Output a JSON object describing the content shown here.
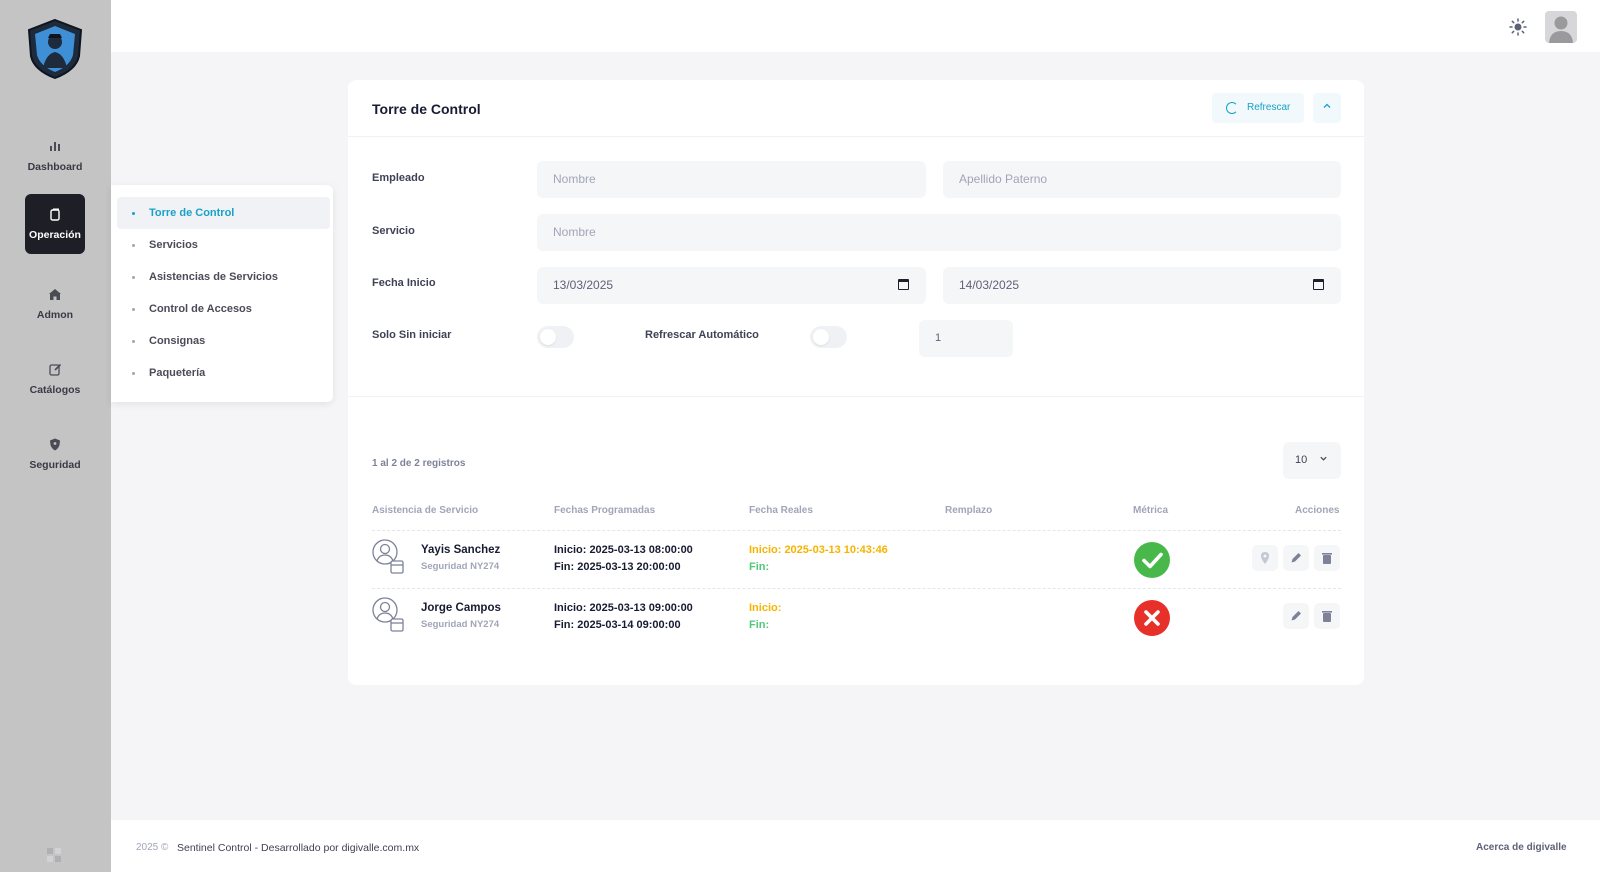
{
  "sidebar": {
    "items": [
      {
        "label": "Dashboard",
        "icon": "bar-chart-icon"
      },
      {
        "label": "Operación",
        "icon": "copy-icon"
      },
      {
        "label": "Admon",
        "icon": "home-icon"
      },
      {
        "label": "Catálogos",
        "icon": "edit-icon"
      },
      {
        "label": "Seguridad",
        "icon": "shield-icon"
      }
    ]
  },
  "submenu": {
    "items": [
      "Torre de Control",
      "Servicios",
      "Asistencias de Servicios",
      "Control de Accesos",
      "Consignas",
      "Paquetería"
    ]
  },
  "card": {
    "title": "Torre de Control",
    "refresh_label": "Refrescar"
  },
  "filters": {
    "empleado_label": "Empleado",
    "nombre_placeholder": "Nombre",
    "apellido_placeholder": "Apellido Paterno",
    "servicio_label": "Servicio",
    "servicio_placeholder": "Nombre",
    "fecha_label": "Fecha Inicio",
    "fecha_inicio": "13/03/2025",
    "fecha_fin": "14/03/2025",
    "solo_label": "Solo Sin iniciar",
    "auto_label": "Refrescar Automático",
    "interval": "1"
  },
  "table": {
    "records_text": "1 al 2 de 2 registros",
    "page_size": "10",
    "headers": [
      "Asistencia de Servicio",
      "Fechas Programadas",
      "Fecha Reales",
      "Remplazo",
      "Métrica",
      "Acciones"
    ],
    "rows": [
      {
        "name": "Yayis Sanchez",
        "service": "Seguridad NY274",
        "sched_start": "Inicio: 2025-03-13 08:00:00",
        "sched_end": "Fin: 2025-03-13 20:00:00",
        "real_start": "Inicio: 2025-03-13 10:43:46",
        "real_end": "Fin:",
        "metric": "success"
      },
      {
        "name": "Jorge Campos",
        "service": "Seguridad NY274",
        "sched_start": "Inicio: 2025-03-13 09:00:00",
        "sched_end": "Fin: 2025-03-14 09:00:00",
        "real_start": "Inicio:",
        "real_end": "Fin:",
        "metric": "failure"
      }
    ]
  },
  "footer": {
    "year": "2025 ©",
    "text": "Sentinel Control - Desarrollado por digivalle.com.mx",
    "about": "Acerca de digivalle"
  },
  "colors": {
    "accent": "#17a2c7",
    "warning": "#f5b400",
    "success": "#48b84b",
    "danger": "#e8302b"
  }
}
